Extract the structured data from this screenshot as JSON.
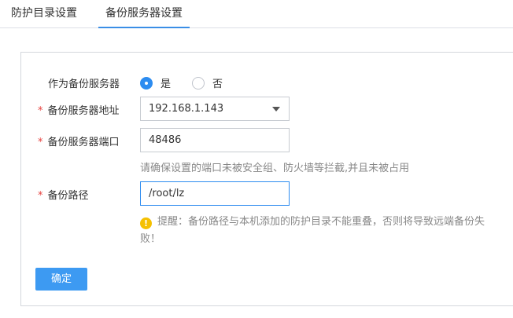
{
  "tabs": [
    {
      "label": "防护目录设置",
      "active": false
    },
    {
      "label": "备份服务器设置",
      "active": true
    }
  ],
  "form": {
    "as_backup_label": "作为备份服务器",
    "radio_yes": "是",
    "radio_no": "否",
    "selected": "是",
    "required_mark": "*",
    "address_label": "备份服务器地址",
    "address_value": "192.168.1.143",
    "port_label": "备份服务器端口",
    "port_value": "48486",
    "port_hint": "请确保设置的端口未被安全组、防火墙等拦截,并且未被占用",
    "path_label": "备份路径",
    "path_value": "/root/lz",
    "warning_icon": "!",
    "warning_text": "提醒：备份路径与本机添加的防护目录不能重叠，否则将导致远端备份失败！",
    "confirm_label": "确定"
  },
  "colors": {
    "accent": "#2d8cf0",
    "button": "#3d9af2",
    "required": "#e64340",
    "warning": "#f5c000",
    "hint_text": "#888888"
  },
  "icons": [
    "radio-checked-icon",
    "radio-unchecked-icon",
    "dropdown-caret-icon",
    "warning-icon"
  ]
}
